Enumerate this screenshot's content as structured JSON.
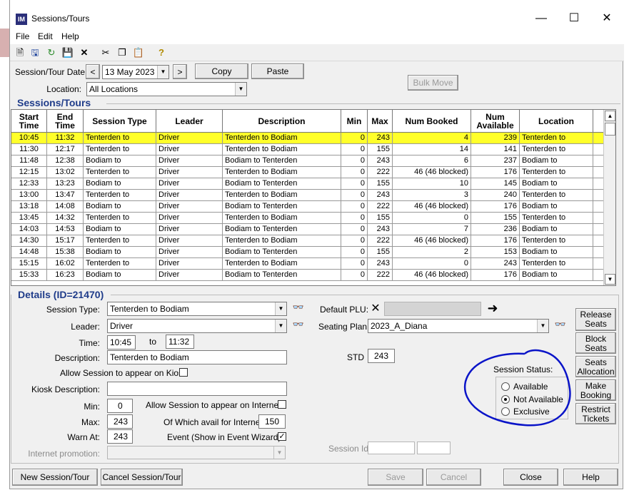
{
  "window": {
    "title": "Sessions/Tours",
    "app_icon": "IM"
  },
  "menu": [
    "File",
    "Edit",
    "Help"
  ],
  "toolbar_icons": [
    "new-icon",
    "save-as-icon",
    "refresh-icon",
    "disk-icon",
    "delete-icon",
    "cut-icon",
    "copy-icon",
    "paste-icon",
    "help-icon"
  ],
  "filters": {
    "date_label": "Session/Tour Date:",
    "date_value": "13 May 2023",
    "copy_label": "Copy",
    "paste_label": "Paste",
    "bulk_move_label": "Bulk Move",
    "location_label": "Location:",
    "location_value": "All Locations"
  },
  "grid": {
    "title": "Sessions/Tours",
    "columns": [
      "Start Time",
      "End Time",
      "Session Type",
      "Leader",
      "Description",
      "Min",
      "Max",
      "Num Booked",
      "Num Available",
      "Location"
    ],
    "rows": [
      [
        "10:45",
        "11:32",
        "Tenterden to",
        "Driver",
        "Tenterden to Bodiam",
        "0",
        "243",
        "4",
        "239",
        "Tenterden to"
      ],
      [
        "11:30",
        "12:17",
        "Tenterden to",
        "Driver",
        "Tenterden to Bodiam",
        "0",
        "155",
        "14",
        "141",
        "Tenterden to"
      ],
      [
        "11:48",
        "12:38",
        "Bodiam to",
        "Driver",
        "Bodiam to Tenterden",
        "0",
        "243",
        "6",
        "237",
        "Bodiam to"
      ],
      [
        "12:15",
        "13:02",
        "Tenterden to",
        "Driver",
        "Tenterden to Bodiam",
        "0",
        "222",
        "46 (46 blocked)",
        "176",
        "Tenterden to"
      ],
      [
        "12:33",
        "13:23",
        "Bodiam to",
        "Driver",
        "Bodiam to Tenterden",
        "0",
        "155",
        "10",
        "145",
        "Bodiam to"
      ],
      [
        "13:00",
        "13:47",
        "Tenterden to",
        "Driver",
        "Tenterden to Bodiam",
        "0",
        "243",
        "3",
        "240",
        "Tenterden to"
      ],
      [
        "13:18",
        "14:08",
        "Bodiam to",
        "Driver",
        "Bodiam to Tenterden",
        "0",
        "222",
        "46 (46 blocked)",
        "176",
        "Bodiam to"
      ],
      [
        "13:45",
        "14:32",
        "Tenterden to",
        "Driver",
        "Tenterden to Bodiam",
        "0",
        "155",
        "0",
        "155",
        "Tenterden to"
      ],
      [
        "14:03",
        "14:53",
        "Bodiam to",
        "Driver",
        "Bodiam to Tenterden",
        "0",
        "243",
        "7",
        "236",
        "Bodiam to"
      ],
      [
        "14:30",
        "15:17",
        "Tenterden to",
        "Driver",
        "Tenterden to Bodiam",
        "0",
        "222",
        "46 (46 blocked)",
        "176",
        "Tenterden to"
      ],
      [
        "14:48",
        "15:38",
        "Bodiam to",
        "Driver",
        "Bodiam to Tenterden",
        "0",
        "155",
        "2",
        "153",
        "Bodiam to"
      ],
      [
        "15:15",
        "16:02",
        "Tenterden to",
        "Driver",
        "Tenterden to Bodiam",
        "0",
        "243",
        "0",
        "243",
        "Tenterden to"
      ],
      [
        "15:33",
        "16:23",
        "Bodiam to",
        "Driver",
        "Bodiam to Tenterden",
        "0",
        "222",
        "46 (46 blocked)",
        "176",
        "Bodiam to"
      ]
    ],
    "selected_row": 0
  },
  "details": {
    "title": "Details (ID=21470)",
    "session_type_label": "Session Type:",
    "session_type_value": "Tenterden to Bodiam",
    "leader_label": "Leader:",
    "leader_value": "Driver",
    "time_label": "Time:",
    "time_start": "10:45",
    "time_to": "to",
    "time_end": "11:32",
    "description_label": "Description:",
    "description_value": "Tenterden to Bodiam",
    "kiosk_allow_label": "Allow Session to appear on Kiosk",
    "kiosk_allow_checked": false,
    "kiosk_desc_label": "Kiosk Description:",
    "kiosk_desc_value": "",
    "min_label": "Min:",
    "min_value": "0",
    "max_label": "Max:",
    "max_value": "243",
    "warn_label": "Warn At:",
    "warn_value": "243",
    "internet_allow_label": "Allow Session to appear on Internet",
    "internet_allow_checked": false,
    "internet_avail_label": "Of Which avail for Internet:",
    "internet_avail_value": "150",
    "event_label": "Event (Show in Event Wizard)",
    "event_checked": true,
    "event_check_mark": "✓",
    "internet_promo_label": "Internet promotion:",
    "internet_promo_value": "",
    "default_plu_label": "Default PLU:",
    "seating_plan_label": "Seating Plan:",
    "seating_plan_value": "2023_A_Diana",
    "std_label": "STD",
    "std_value": "243",
    "session_id_label": "Session Id",
    "status": {
      "label": "Session Status:",
      "options": [
        "Available",
        "Not Available",
        "Exclusive"
      ],
      "selected": 1
    },
    "side_buttons": [
      "Release Seats",
      "Block Seats",
      "Seats Allocation",
      "Make Booking",
      "Restrict Tickets"
    ]
  },
  "footer": {
    "new_label": "New Session/Tour",
    "cancel_session_label": "Cancel Session/Tour",
    "save_label": "Save",
    "cancel_label": "Cancel",
    "close_label": "Close",
    "help_label": "Help"
  },
  "annotation_color": "#0a14c8",
  "highlight_color": "#ffff2a",
  "accent_color": "#1f3c8a"
}
